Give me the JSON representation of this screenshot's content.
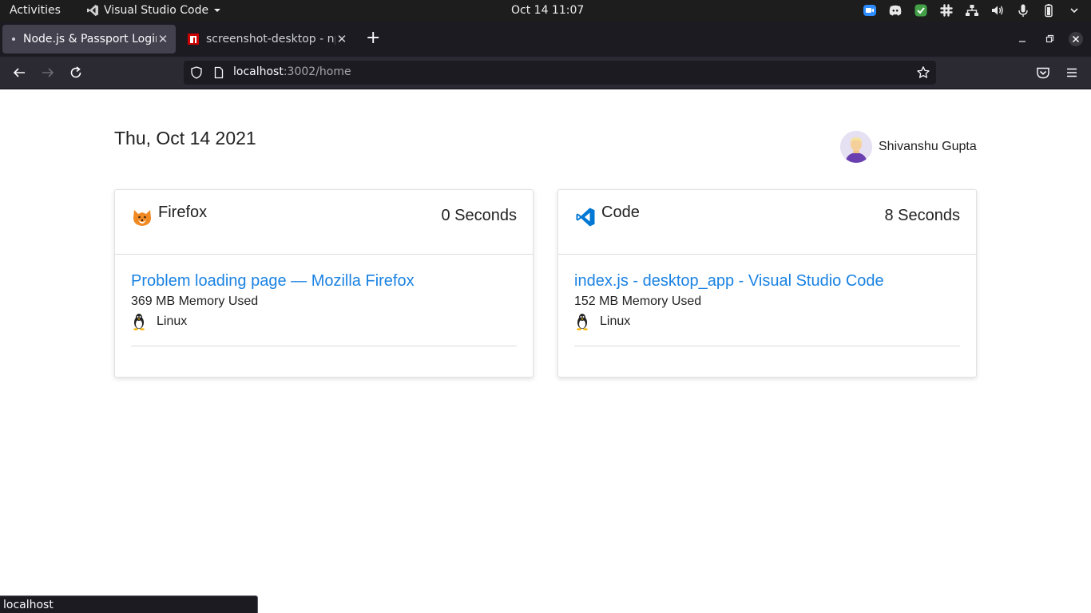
{
  "topbar": {
    "activities": "Activities",
    "app_name": "Visual Studio Code",
    "clock": "Oct 14  11:07"
  },
  "tabs": [
    {
      "title": "Node.js & Passport Login",
      "active": true
    },
    {
      "title": "screenshot-desktop - npm",
      "active": false
    }
  ],
  "url": {
    "host": "localhost",
    "rest": ":3002/home"
  },
  "page": {
    "date": "Thu, Oct 14 2021",
    "user_name": "Shivanshu Gupta"
  },
  "cards": [
    {
      "app": "Firefox",
      "duration": "0 Seconds",
      "window_title": "Problem loading page — Mozilla Firefox",
      "memory": "369 MB Memory Used",
      "os": "Linux",
      "icon": "firefox-icon"
    },
    {
      "app": "Code",
      "duration": "8 Seconds",
      "window_title": "index.js - desktop_app - Visual Studio Code",
      "memory": "152 MB Memory Used",
      "os": "Linux",
      "icon": "vscode-icon"
    }
  ],
  "status_bar": "localhost",
  "colors": {
    "link": "#1a82e2",
    "chrome_dark": "#2b2a33",
    "topbar": "#1d1d1d"
  }
}
